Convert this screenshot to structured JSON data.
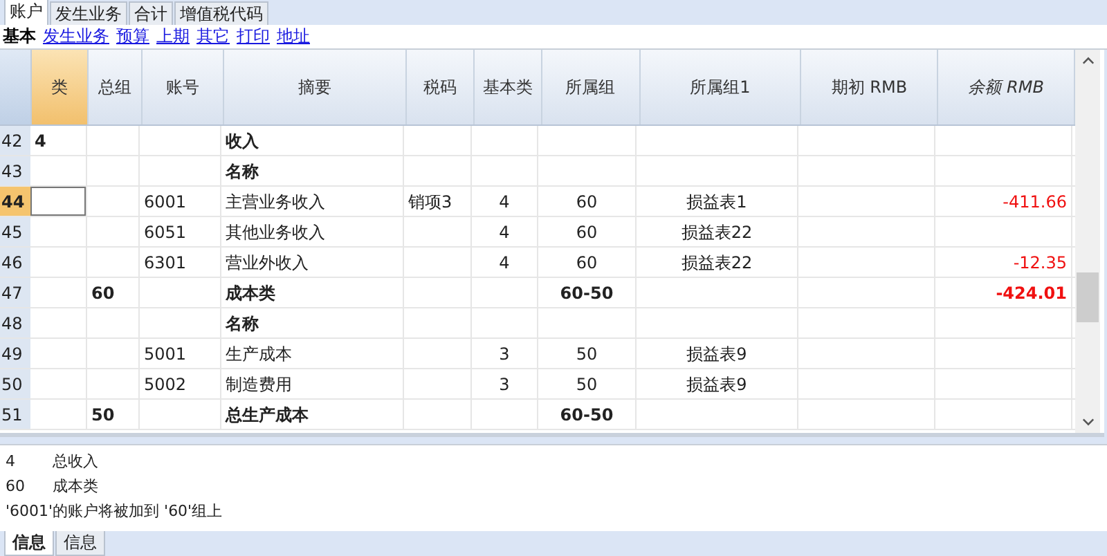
{
  "tabs": [
    {
      "label": "账户",
      "selected": true
    },
    {
      "label": "发生业务",
      "selected": false
    },
    {
      "label": "合计",
      "selected": false
    },
    {
      "label": "增值税代码",
      "selected": false
    }
  ],
  "views": [
    {
      "label": "基本",
      "selected": true
    },
    {
      "label": "发生业务",
      "selected": false
    },
    {
      "label": "预算",
      "selected": false
    },
    {
      "label": "上期",
      "selected": false
    },
    {
      "label": "其它",
      "selected": false
    },
    {
      "label": "打印",
      "selected": false
    },
    {
      "label": "地址",
      "selected": false
    }
  ],
  "table": {
    "columns": [
      {
        "label": "类",
        "selected": true,
        "italic": false
      },
      {
        "label": "总组",
        "selected": false,
        "italic": false
      },
      {
        "label": "账号",
        "selected": false,
        "italic": false
      },
      {
        "label": "摘要",
        "selected": false,
        "italic": false
      },
      {
        "label": "税码",
        "selected": false,
        "italic": false
      },
      {
        "label": "基本类",
        "selected": false,
        "italic": false
      },
      {
        "label": "所属组",
        "selected": false,
        "italic": false
      },
      {
        "label": "所属组1",
        "selected": false,
        "italic": false
      },
      {
        "label": "期初 RMB",
        "selected": false,
        "italic": false
      },
      {
        "label": "余额 RMB",
        "selected": false,
        "italic": true
      }
    ],
    "rows": [
      {
        "num": "42",
        "selected": false,
        "bold": true,
        "cells": [
          "4",
          "",
          "",
          "收入",
          "",
          "",
          "",
          "",
          "",
          ""
        ]
      },
      {
        "num": "43",
        "selected": false,
        "bold": true,
        "cells": [
          "",
          "",
          "",
          "名称",
          "",
          "",
          "",
          "",
          "",
          ""
        ]
      },
      {
        "num": "44",
        "selected": true,
        "bold": false,
        "negative": true,
        "cells": [
          "",
          "",
          "6001",
          "主营业务收入",
          "销项3",
          "4",
          "60",
          "损益表1",
          "",
          "-411.66"
        ]
      },
      {
        "num": "45",
        "selected": false,
        "bold": false,
        "cells": [
          "",
          "",
          "6051",
          "其他业务收入",
          "",
          "4",
          "60",
          "损益表22",
          "",
          ""
        ]
      },
      {
        "num": "46",
        "selected": false,
        "bold": false,
        "negative": true,
        "cells": [
          "",
          "",
          "6301",
          "营业外收入",
          "",
          "4",
          "60",
          "损益表22",
          "",
          "-12.35"
        ]
      },
      {
        "num": "47",
        "selected": false,
        "bold": true,
        "negative": true,
        "cells": [
          "",
          "60",
          "",
          "成本类",
          "",
          "",
          "60-50",
          "",
          "",
          "-424.01"
        ]
      },
      {
        "num": "48",
        "selected": false,
        "bold": true,
        "cells": [
          "",
          "",
          "",
          "名称",
          "",
          "",
          "",
          "",
          "",
          ""
        ]
      },
      {
        "num": "49",
        "selected": false,
        "bold": false,
        "cells": [
          "",
          "",
          "5001",
          "生产成本",
          "",
          "3",
          "50",
          "损益表9",
          "",
          ""
        ]
      },
      {
        "num": "50",
        "selected": false,
        "bold": false,
        "cells": [
          "",
          "",
          "5002",
          "制造费用",
          "",
          "3",
          "50",
          "损益表9",
          "",
          ""
        ]
      },
      {
        "num": "51",
        "selected": false,
        "bold": true,
        "cells": [
          "",
          "50",
          "",
          "总生产成本",
          "",
          "",
          "60-50",
          "",
          "",
          ""
        ]
      }
    ]
  },
  "messages": [
    {
      "kind": "pair",
      "code": "4",
      "text": "总收入"
    },
    {
      "kind": "pair",
      "code": "60",
      "text": "成本类"
    },
    {
      "kind": "line",
      "text": "'6001'的账户将被加到 '60'组上"
    }
  ],
  "bottom_tabs": [
    {
      "label": "信息",
      "selected": true
    },
    {
      "label": "信息",
      "selected": false
    }
  ]
}
